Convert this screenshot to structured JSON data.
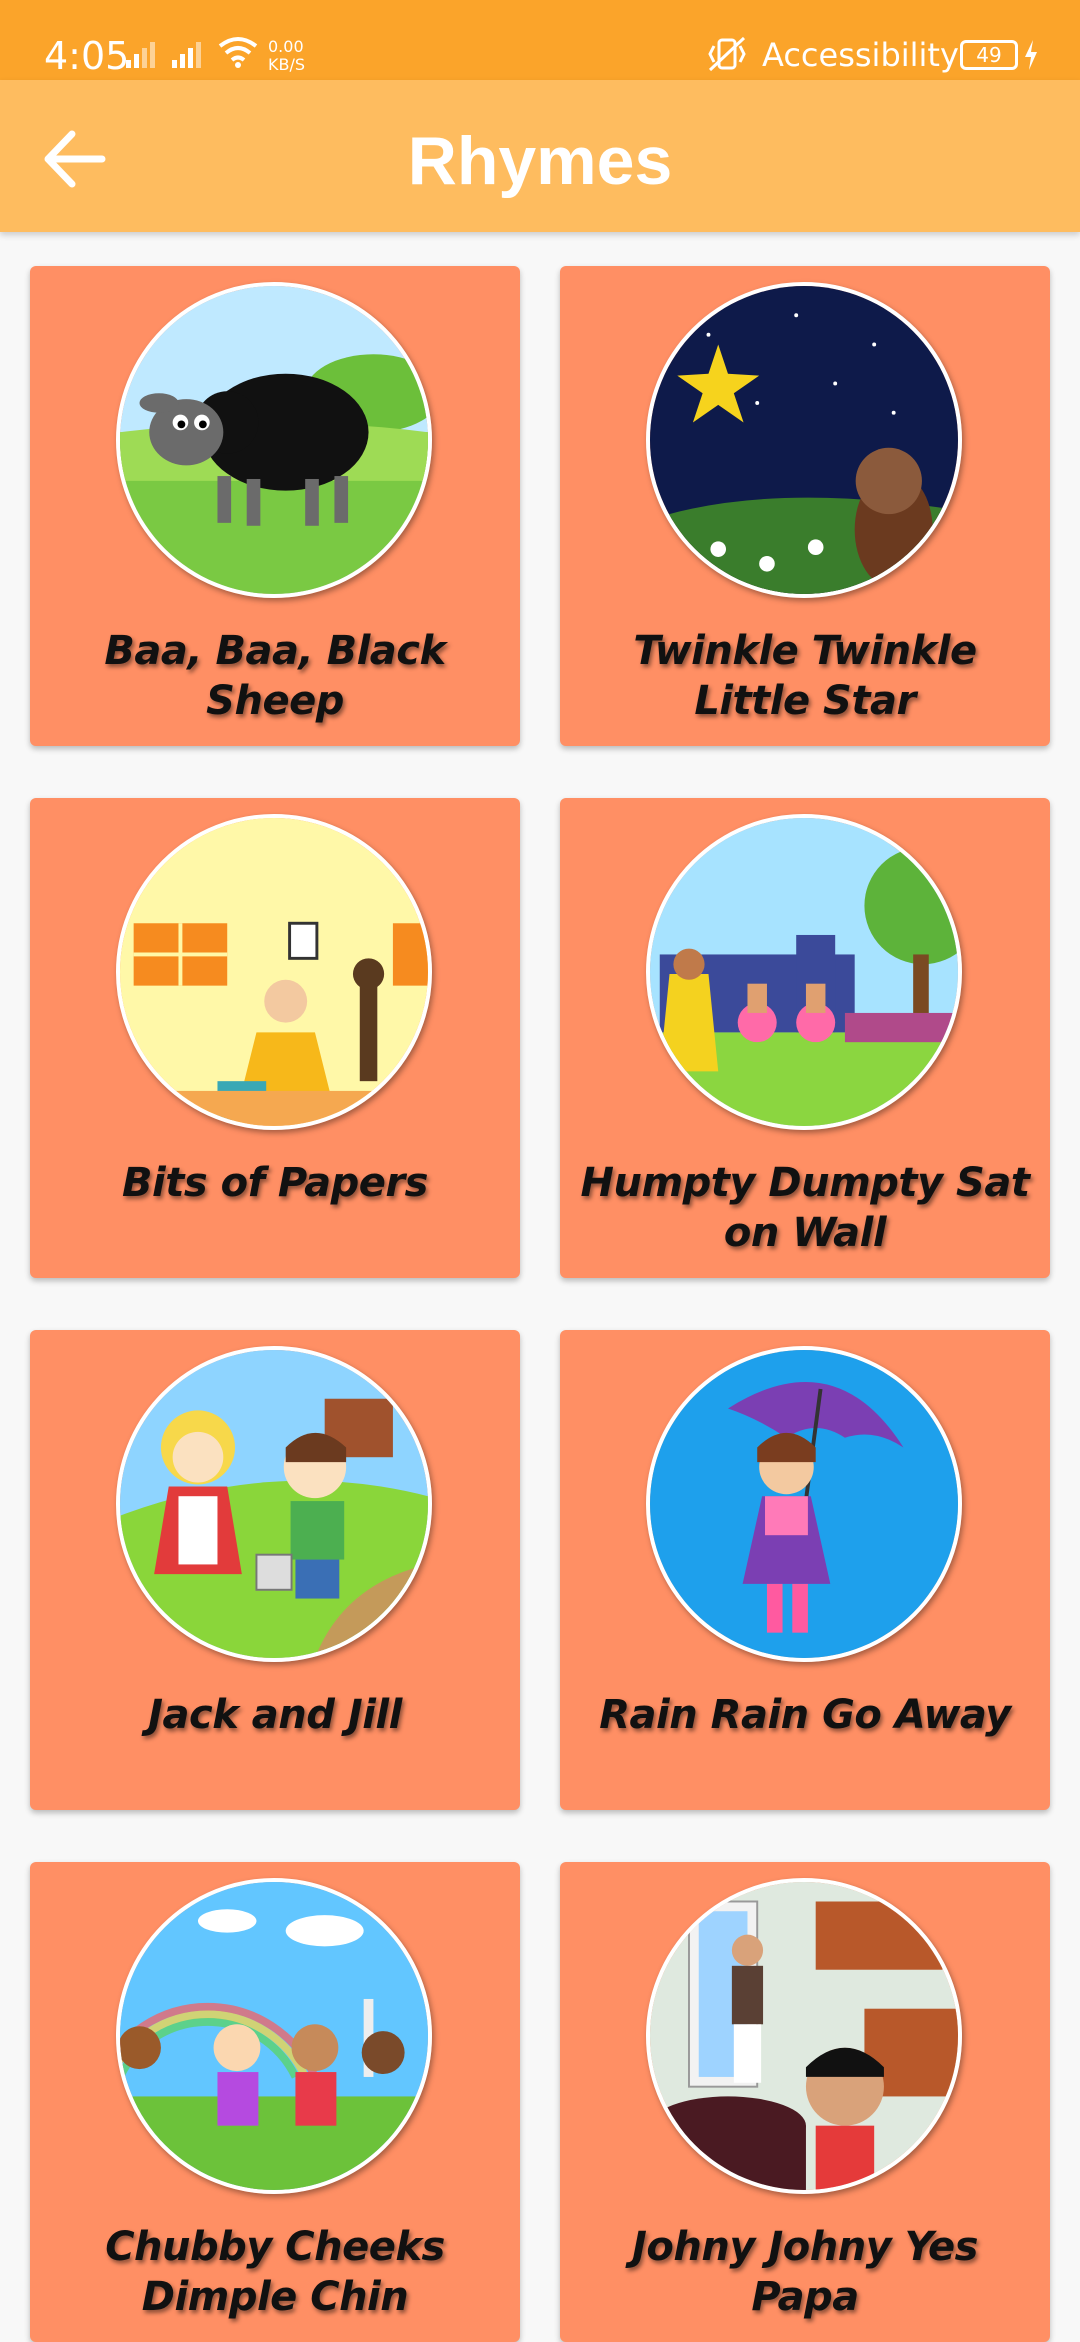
{
  "status_bar": {
    "time": "4:05",
    "speed_value": "0.00",
    "speed_unit": "KB/S",
    "accessibility_label": "Accessibility",
    "battery": "49"
  },
  "app_bar": {
    "title": "Rhymes"
  },
  "rhymes": [
    {
      "title": "Baa, Baa, Black Sheep",
      "thumb_icon": "black-sheep-image"
    },
    {
      "title": "Twinkle Twinkle Little Star",
      "thumb_icon": "night-star-image"
    },
    {
      "title": "Bits of Papers",
      "thumb_icon": "girl-cleaning-image"
    },
    {
      "title": "Humpty Dumpty Sat on Wall",
      "thumb_icon": "castle-soldiers-image"
    },
    {
      "title": "Jack and Jill",
      "thumb_icon": "jack-jill-hill-image"
    },
    {
      "title": "Rain Rain Go Away",
      "thumb_icon": "girl-umbrella-image"
    },
    {
      "title": "Chubby Cheeks Dimple Chin",
      "thumb_icon": "children-rainbow-image"
    },
    {
      "title": "Johny Johny Yes Papa",
      "thumb_icon": "johny-kitchen-image"
    }
  ],
  "colors": {
    "status_bar": "#fba42a",
    "app_bar": "#febc5f",
    "card": "#ff8f64",
    "background": "#f8f8f8"
  }
}
